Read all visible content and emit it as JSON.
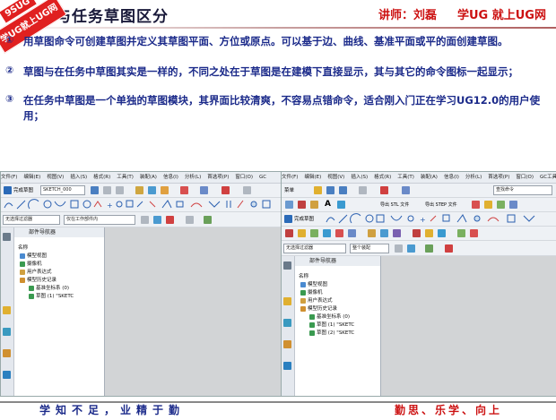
{
  "header": {
    "title": "与任务草图区分",
    "lecturer": "讲师：刘磊",
    "site": "学UG   就上UG网",
    "watermark_line1": "9SUG",
    "watermark_line2": "学UG就上UG网"
  },
  "bullets": [
    {
      "num": "①",
      "text": "用草图命令可创建草图并定义其草图平面、方位或原点。可以基于边、曲线、基准平面或平的面创建草图。"
    },
    {
      "num": "②",
      "text": "草图与在任务中草图其实是一样的，不同之处在于草图是在建模下直接显示，其与其它的命令图标一起显示；"
    },
    {
      "num": "③",
      "text": "在任务中草图是一个单独的草图模块，其界面比较清爽，不容易点错命令，适合刚入门正在学习UG12.0的用户使用；"
    }
  ],
  "left_window": {
    "menu": [
      "文件(F)",
      "编辑(E)",
      "视图(V)",
      "插入(S)",
      "格式(R)",
      "工具(T)",
      "装配(A)",
      "信息(I)",
      "分析(L)",
      "首选项(P)",
      "窗口(O)",
      "GC"
    ],
    "finish_label": "完成草图",
    "sketch_name": "SKETCH_000",
    "filter_select": "无选择过滤器",
    "scope_select": "仅在工作部件内",
    "navigator_title": "部件导航器",
    "column_header": "名称",
    "tree": [
      {
        "indent": 0,
        "label": "模型视图"
      },
      {
        "indent": 0,
        "label": "摄像机"
      },
      {
        "indent": 0,
        "label": "用户表达式"
      },
      {
        "indent": 0,
        "label": "模型历史记录"
      },
      {
        "indent": 1,
        "label": "基准坐标系 (0)"
      },
      {
        "indent": 1,
        "label": "草图 (1) \"SKETC"
      }
    ]
  },
  "right_window": {
    "menu": [
      "文件(F)",
      "编辑(E)",
      "视图(V)",
      "插入(S)",
      "格式(R)",
      "工具(T)",
      "装配(A)",
      "信息(I)",
      "分析(L)",
      "首选项(P)",
      "窗口(O)",
      "GC工具箱",
      "帮助(H)"
    ],
    "menu_label": "菜单",
    "search_placeholder": "查找命令",
    "export_stl": "导出 STL 文件",
    "export_step": "导出 STEP 文件",
    "finish_label": "完成草图",
    "filter_select": "无选择过滤器",
    "scope_select": "整个装配",
    "navigator_title": "部件导航器",
    "column_header": "名称",
    "tree": [
      {
        "indent": 0,
        "label": "模型视图"
      },
      {
        "indent": 0,
        "label": "摄像机"
      },
      {
        "indent": 0,
        "label": "用户表达式"
      },
      {
        "indent": 0,
        "label": "模型历史记录"
      },
      {
        "indent": 1,
        "label": "基准坐标系 (0)"
      },
      {
        "indent": 1,
        "label": "草图 (1) \"SKETC"
      },
      {
        "indent": 1,
        "label": "草图 (2) \"SKETC"
      }
    ]
  },
  "footer": {
    "motto": "学知不足，业精于勤",
    "slogan": "勤思、乐学、向上"
  },
  "colors": {
    "accent_red": "#cc1111",
    "text_blue": "#1b2a8a",
    "watermark": "#e02020"
  }
}
